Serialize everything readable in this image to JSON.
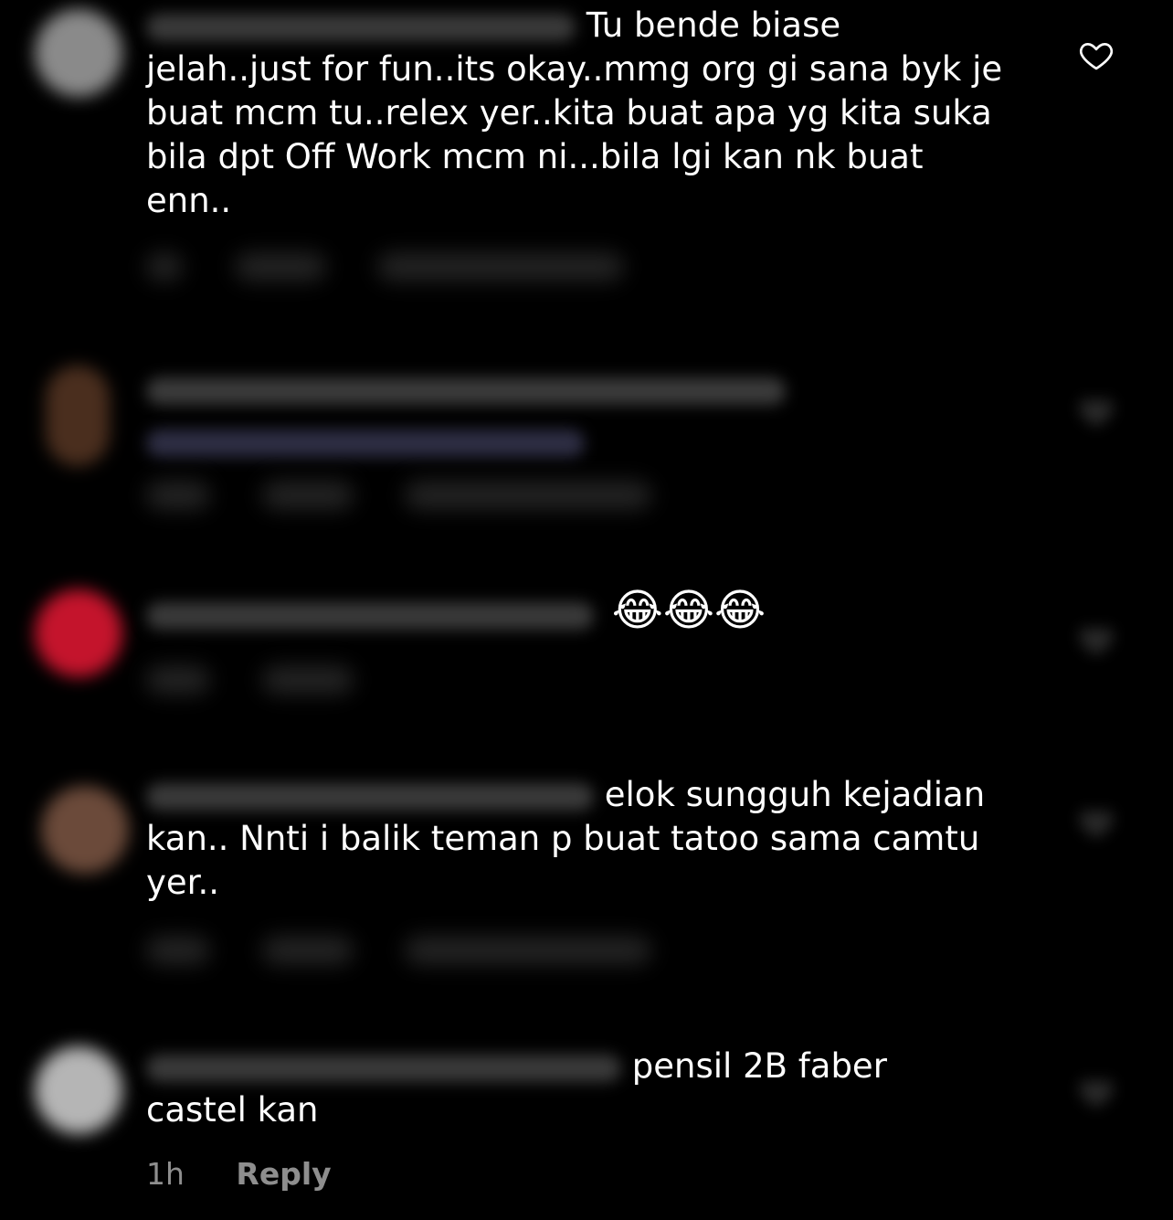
{
  "colors": {
    "background": "#000000",
    "text": "#ffffff",
    "meta_text": "#8e8e8e"
  },
  "comments": [
    {
      "text_line1": "Tu bende biase",
      "text_rest": "jelah..just for fun..its okay..mmg org gi sana byk je buat mcm tu..relex yer..kita buat apa yg kita suka bila dpt Off Work mcm ni...bila lgi kan nk buat enn..",
      "heart_icon": "heart-outline-icon"
    },
    {
      "heart_icon": "heart-outline-icon"
    },
    {
      "emoji": "😂😂😂",
      "heart_icon": "heart-outline-icon"
    },
    {
      "text_line1": "elok sungguh kejadian",
      "text_rest": "kan.. Nnti i balik teman p buat tatoo sama camtu yer..",
      "heart_icon": "heart-outline-icon"
    },
    {
      "text_line1": "pensil 2B faber",
      "text_rest": "castel kan",
      "time": "1h",
      "reply_label": "Reply",
      "heart_icon": "heart-outline-icon"
    }
  ]
}
